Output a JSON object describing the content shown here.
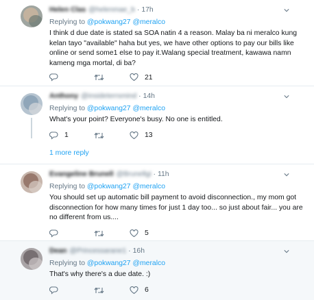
{
  "tweets": [
    {
      "name": "Helen Clas",
      "handle": "@helenmae_b",
      "time": "17h",
      "replying_prefix": "Replying to",
      "mention1": "@pokwang27",
      "mention2": "@meralco",
      "text": "I think d due date is stated sa SOA natin 4 a reason. Malay ba ni meralco kung kelan tayo \"available\" haha but yes, we have other options to pay our bills like online or send some1 else to pay it.Walang special treatment, kawawa namn kameng mga mortal, di ba?",
      "reply_count": "",
      "retweet_count": "",
      "like_count": "21"
    },
    {
      "name": "Anthony",
      "handle": "@insideterrsmind",
      "time": "14h",
      "replying_prefix": "Replying to",
      "mention1": "@pokwang27",
      "mention2": "@meralco",
      "text": "What's your point? Everyone's busy. No one is entitled.",
      "reply_count": "1",
      "retweet_count": "",
      "like_count": "13"
    },
    {
      "name": "Evangeline Brunell",
      "handle": "@Brunellgi",
      "time": "11h",
      "replying_prefix": "Replying to",
      "mention1": "@pokwang27",
      "mention2": "@meralco",
      "text": "You should set up automatic bill payment to avoid disconnection., my mom got disconnection for how many times for just 1 day too... so just about fair... you are no different from us....",
      "reply_count": "",
      "retweet_count": "",
      "like_count": "5"
    },
    {
      "name": "Dean",
      "handle": "@Princessarane1",
      "time": "16h",
      "replying_prefix": "Replying to",
      "mention1": "@pokwang27",
      "mention2": "@meralco",
      "text": "That's why there's a due date. :)",
      "reply_count": "",
      "retweet_count": "",
      "like_count": "6"
    }
  ],
  "more_replies_label": "1 more reply",
  "colors": {
    "accent": "#1da1f2",
    "muted": "#657786",
    "divider": "#e6ecf0",
    "shaded_bg": "#f5f8fa"
  },
  "icons": {
    "reply": "reply-icon",
    "retweet": "retweet-icon",
    "like": "heart-icon",
    "caret": "chevron-down-icon"
  }
}
